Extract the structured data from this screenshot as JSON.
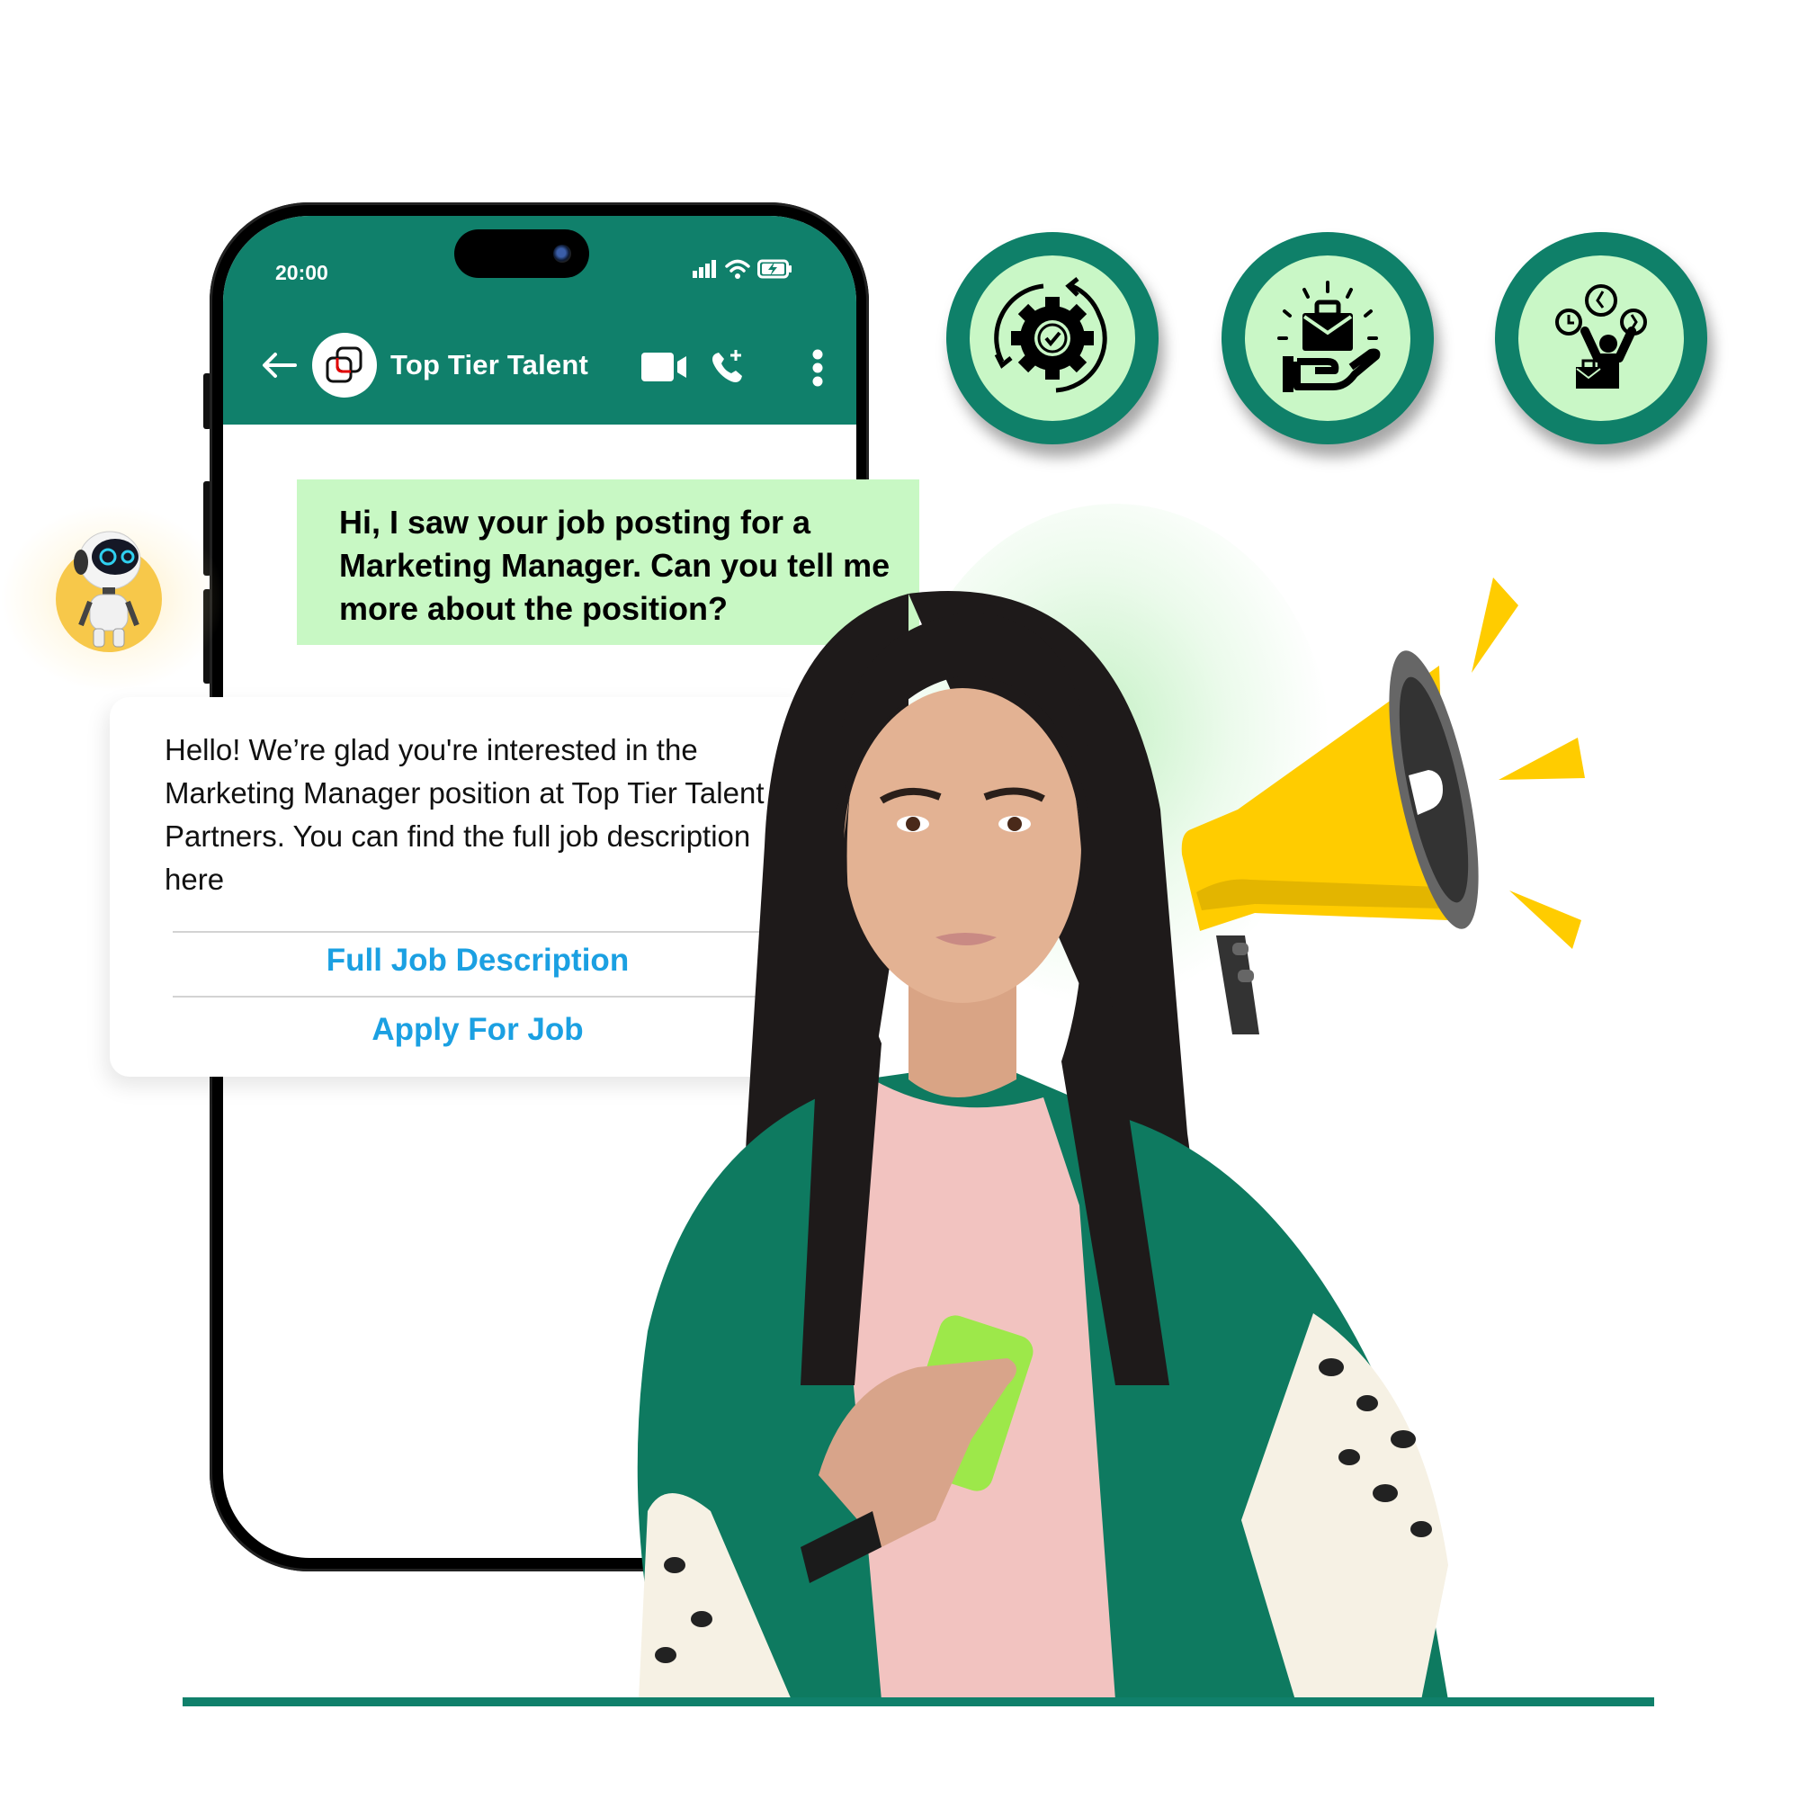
{
  "phone": {
    "status_bar": {
      "time": "20:00",
      "icons": [
        "signal-icon",
        "wifi-icon",
        "battery-charging-icon"
      ]
    },
    "chat_header": {
      "back_icon": "arrow-left-icon",
      "contact_name": "Top Tier Talent",
      "actions": [
        "video-call-icon",
        "add-call-icon",
        "more-vertical-icon"
      ]
    }
  },
  "messages": {
    "user": {
      "text": "Hi, I saw your job posting for a Marketing Manager. Can you tell me more about the position?"
    },
    "bot": {
      "text": "Hello! We’re glad you're interested in the Marketing Manager position at Top Tier Talent Partners. You can find the full job description here",
      "buttons": [
        {
          "label": "Full Job Description"
        },
        {
          "label": "Apply For Job"
        }
      ]
    }
  },
  "feature_icons": [
    {
      "icon": "gear-check-cycle-icon"
    },
    {
      "icon": "hand-briefcase-icon"
    },
    {
      "icon": "person-clocks-briefcase-icon"
    }
  ],
  "decor": {
    "robot_avatar": "robot-icon",
    "megaphone": "megaphone-icon",
    "person": "woman-holding-phone"
  },
  "colors": {
    "brand_green": "#10806b",
    "bubble_green": "#c8f8c4",
    "link_blue": "#1ba0e2",
    "megaphone_yellow": "#ffcc00"
  }
}
